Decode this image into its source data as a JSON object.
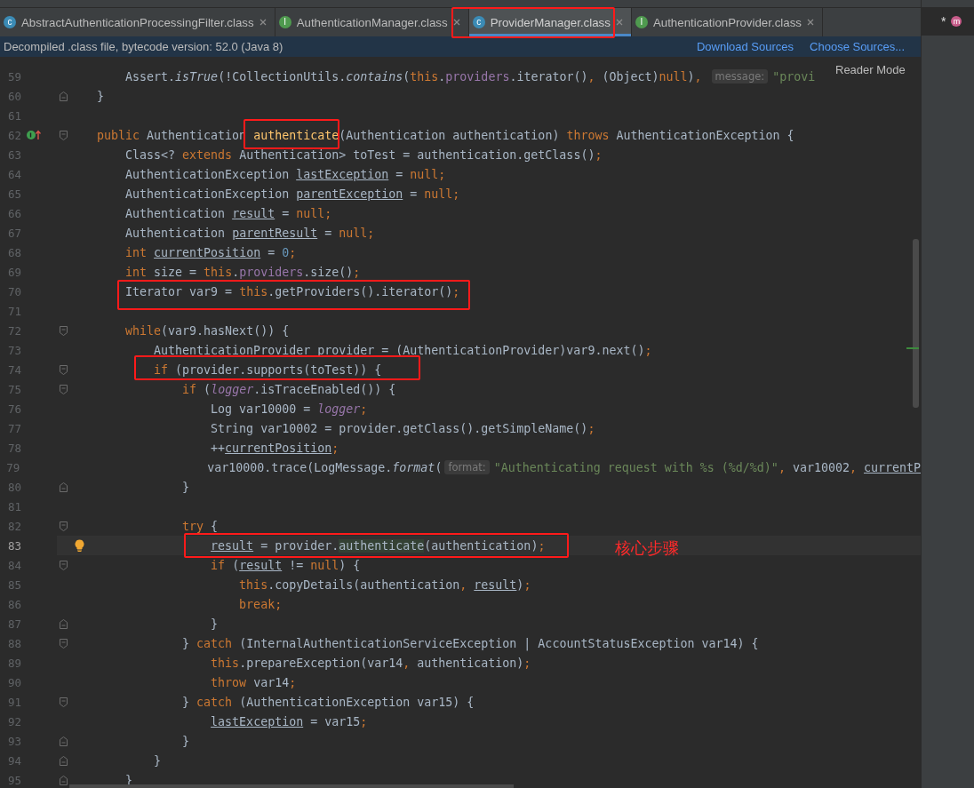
{
  "tabs": [
    {
      "label": "AbstractAuthenticationProcessingFilter.class",
      "kind": "class",
      "badge": "c",
      "selected": false
    },
    {
      "label": "AuthenticationManager.class",
      "kind": "interface",
      "badge": "I",
      "selected": false
    },
    {
      "label": "ProviderManager.class",
      "kind": "class",
      "badge": "c",
      "selected": true
    },
    {
      "label": "AuthenticationProvider.class",
      "kind": "interface",
      "badge": "I",
      "selected": false
    }
  ],
  "side_panel": {
    "mark": "*",
    "badge": "m"
  },
  "info_bar": {
    "message": "Decompiled .class file, bytecode version: 52.0 (Java 8)",
    "links": [
      "Download Sources",
      "Choose Sources..."
    ]
  },
  "reader_mode": "Reader Mode",
  "lines": [
    {
      "no": "59",
      "tokens": [
        {
          "kind": "plain",
          "text": "    Assert."
        },
        {
          "kind": "italic",
          "text": "isTrue"
        },
        {
          "kind": "plain",
          "text": "(!CollectionUtils."
        },
        {
          "kind": "italic",
          "text": "contains"
        },
        {
          "kind": "plain",
          "text": "("
        },
        {
          "kind": "keyword",
          "text": "this"
        },
        {
          "kind": "plain",
          "text": "."
        },
        {
          "kind": "field",
          "text": "providers"
        },
        {
          "kind": "plain",
          "text": ".iterator()"
        },
        {
          "kind": "keyword",
          "text": ", "
        },
        {
          "kind": "plain",
          "text": "(Object)"
        },
        {
          "kind": "keyword",
          "text": "null"
        },
        {
          "kind": "plain",
          "text": ")"
        },
        {
          "kind": "keyword",
          "text": ", "
        },
        {
          "kind": "hint",
          "text": "message:"
        },
        {
          "kind": "string",
          "text": "\"provi"
        }
      ]
    },
    {
      "no": "60",
      "fold": {
        "kind": "end"
      },
      "tokens": [
        {
          "kind": "plain",
          "text": "}"
        }
      ]
    },
    {
      "no": "61"
    },
    {
      "no": "62",
      "fold": {
        "kind": "start"
      },
      "gutter": {
        "kind": "implements"
      },
      "tokens": [
        {
          "kind": "keyword",
          "text": "public "
        },
        {
          "kind": "plain",
          "text": "Authentication "
        },
        {
          "kind": "declaration",
          "text": "authenticate"
        },
        {
          "kind": "plain",
          "text": "(Authentication authentication) "
        },
        {
          "kind": "keyword",
          "text": "throws "
        },
        {
          "kind": "plain",
          "text": "AuthenticationException {"
        }
      ]
    },
    {
      "no": "63",
      "tokens": [
        {
          "kind": "plain",
          "text": "    Class<? "
        },
        {
          "kind": "keyword",
          "text": "extends "
        },
        {
          "kind": "plain",
          "text": "Authentication> toTest = authentication.getClass()"
        },
        {
          "kind": "keyword",
          "text": ";"
        }
      ]
    },
    {
      "no": "64",
      "tokens": [
        {
          "kind": "plain",
          "text": "    AuthenticationException "
        },
        {
          "kind": "local",
          "text": "lastException"
        },
        {
          "kind": "plain",
          "text": " = "
        },
        {
          "kind": "keyword",
          "text": "null;"
        }
      ]
    },
    {
      "no": "65",
      "tokens": [
        {
          "kind": "plain",
          "text": "    AuthenticationException "
        },
        {
          "kind": "local",
          "text": "parentException"
        },
        {
          "kind": "plain",
          "text": " = "
        },
        {
          "kind": "keyword",
          "text": "null;"
        }
      ]
    },
    {
      "no": "66",
      "tokens": [
        {
          "kind": "plain",
          "text": "    Authentication "
        },
        {
          "kind": "local",
          "text": "result"
        },
        {
          "kind": "plain",
          "text": " = "
        },
        {
          "kind": "keyword",
          "text": "null;"
        }
      ]
    },
    {
      "no": "67",
      "tokens": [
        {
          "kind": "plain",
          "text": "    Authentication "
        },
        {
          "kind": "local",
          "text": "parentResult"
        },
        {
          "kind": "plain",
          "text": " = "
        },
        {
          "kind": "keyword",
          "text": "null;"
        }
      ]
    },
    {
      "no": "68",
      "tokens": [
        {
          "kind": "keyword",
          "text": "    int "
        },
        {
          "kind": "local",
          "text": "currentPosition"
        },
        {
          "kind": "plain",
          "text": " = "
        },
        {
          "kind": "number",
          "text": "0"
        },
        {
          "kind": "keyword",
          "text": ";"
        }
      ]
    },
    {
      "no": "69",
      "tokens": [
        {
          "kind": "keyword",
          "text": "    int "
        },
        {
          "kind": "plain",
          "text": "size = "
        },
        {
          "kind": "keyword",
          "text": "this"
        },
        {
          "kind": "plain",
          "text": "."
        },
        {
          "kind": "field",
          "text": "providers"
        },
        {
          "kind": "plain",
          "text": ".size()"
        },
        {
          "kind": "keyword",
          "text": ";"
        }
      ]
    },
    {
      "no": "70",
      "tokens": [
        {
          "kind": "plain",
          "text": "    Iterator var9 = "
        },
        {
          "kind": "keyword",
          "text": "this"
        },
        {
          "kind": "plain",
          "text": ".getProviders().iterator()"
        },
        {
          "kind": "keyword",
          "text": ";"
        }
      ]
    },
    {
      "no": "71"
    },
    {
      "no": "72",
      "fold": {
        "kind": "start"
      },
      "tokens": [
        {
          "kind": "keyword",
          "text": "    while"
        },
        {
          "kind": "plain",
          "text": "(var9.hasNext()) {"
        }
      ]
    },
    {
      "no": "73",
      "tokens": [
        {
          "kind": "plain",
          "text": "        AuthenticationProvider provider = (AuthenticationProvider)var9.next()"
        },
        {
          "kind": "keyword",
          "text": ";"
        }
      ]
    },
    {
      "no": "74",
      "fold": {
        "kind": "start"
      },
      "tokens": [
        {
          "kind": "keyword",
          "text": "        if "
        },
        {
          "kind": "plain",
          "text": "(provider.supports(toTest)) {"
        }
      ]
    },
    {
      "no": "75",
      "fold": {
        "kind": "start"
      },
      "tokens": [
        {
          "kind": "keyword",
          "text": "            if "
        },
        {
          "kind": "plain",
          "text": "("
        },
        {
          "kind": "static",
          "text": "logger"
        },
        {
          "kind": "plain",
          "text": ".isTraceEnabled()) {"
        }
      ]
    },
    {
      "no": "76",
      "tokens": [
        {
          "kind": "plain",
          "text": "                Log var10000 = "
        },
        {
          "kind": "static",
          "text": "logger"
        },
        {
          "kind": "keyword",
          "text": ";"
        }
      ]
    },
    {
      "no": "77",
      "tokens": [
        {
          "kind": "plain",
          "text": "                String var10002 = provider.getClass().getSimpleName()"
        },
        {
          "kind": "keyword",
          "text": ";"
        }
      ]
    },
    {
      "no": "78",
      "tokens": [
        {
          "kind": "plain",
          "text": "                ++"
        },
        {
          "kind": "local",
          "text": "currentPosition"
        },
        {
          "kind": "keyword",
          "text": ";"
        }
      ]
    },
    {
      "no": "79",
      "tokens": [
        {
          "kind": "plain",
          "text": "                var10000.trace(LogMessage."
        },
        {
          "kind": "italic",
          "text": "format"
        },
        {
          "kind": "plain",
          "text": "("
        },
        {
          "kind": "hint",
          "text": "format:"
        },
        {
          "kind": "string",
          "text": "\"Authenticating request with %s (%d/%d)\""
        },
        {
          "kind": "keyword",
          "text": ", "
        },
        {
          "kind": "plain",
          "text": "var10002"
        },
        {
          "kind": "keyword",
          "text": ", "
        },
        {
          "kind": "local",
          "text": "currentP"
        }
      ]
    },
    {
      "no": "80",
      "fold": {
        "kind": "end"
      },
      "tokens": [
        {
          "kind": "plain",
          "text": "            }"
        }
      ]
    },
    {
      "no": "81"
    },
    {
      "no": "82",
      "fold": {
        "kind": "start"
      },
      "tokens": [
        {
          "kind": "keyword",
          "text": "            try "
        },
        {
          "kind": "plain",
          "text": "{"
        }
      ]
    },
    {
      "no": "83",
      "current": true,
      "gutter": {
        "kind": "bulb"
      },
      "tokens": [
        {
          "kind": "local",
          "text": "                result"
        },
        {
          "kind": "plain",
          "text": " = provider."
        },
        {
          "kind": "usage",
          "text": "authenticate"
        },
        {
          "kind": "plain",
          "text": "(authentication)"
        },
        {
          "kind": "keyword",
          "text": ";"
        }
      ]
    },
    {
      "no": "84",
      "fold": {
        "kind": "start"
      },
      "tokens": [
        {
          "kind": "keyword",
          "text": "                if "
        },
        {
          "kind": "plain",
          "text": "("
        },
        {
          "kind": "local",
          "text": "result"
        },
        {
          "kind": "plain",
          "text": " != "
        },
        {
          "kind": "keyword",
          "text": "null"
        },
        {
          "kind": "plain",
          "text": ") {"
        }
      ]
    },
    {
      "no": "85",
      "tokens": [
        {
          "kind": "keyword",
          "text": "                    this"
        },
        {
          "kind": "plain",
          "text": ".copyDetails(authentication"
        },
        {
          "kind": "keyword",
          "text": ", "
        },
        {
          "kind": "local",
          "text": "result"
        },
        {
          "kind": "plain",
          "text": ")"
        },
        {
          "kind": "keyword",
          "text": ";"
        }
      ]
    },
    {
      "no": "86",
      "tokens": [
        {
          "kind": "keyword",
          "text": "                    break;"
        }
      ]
    },
    {
      "no": "87",
      "fold": {
        "kind": "end"
      },
      "tokens": [
        {
          "kind": "plain",
          "text": "                }"
        }
      ]
    },
    {
      "no": "88",
      "fold": {
        "kind": "start"
      },
      "tokens": [
        {
          "kind": "plain",
          "text": "            } "
        },
        {
          "kind": "keyword",
          "text": "catch "
        },
        {
          "kind": "plain",
          "text": "(InternalAuthenticationServiceException | AccountStatusException var14) {"
        }
      ]
    },
    {
      "no": "89",
      "tokens": [
        {
          "kind": "keyword",
          "text": "                this"
        },
        {
          "kind": "plain",
          "text": ".prepareException(var14"
        },
        {
          "kind": "keyword",
          "text": ", "
        },
        {
          "kind": "plain",
          "text": "authentication)"
        },
        {
          "kind": "keyword",
          "text": ";"
        }
      ]
    },
    {
      "no": "90",
      "tokens": [
        {
          "kind": "keyword",
          "text": "                throw "
        },
        {
          "kind": "plain",
          "text": "var14"
        },
        {
          "kind": "keyword",
          "text": ";"
        }
      ]
    },
    {
      "no": "91",
      "fold": {
        "kind": "start"
      },
      "tokens": [
        {
          "kind": "plain",
          "text": "            } "
        },
        {
          "kind": "keyword",
          "text": "catch "
        },
        {
          "kind": "plain",
          "text": "(AuthenticationException var15) {"
        }
      ]
    },
    {
      "no": "92",
      "tokens": [
        {
          "kind": "local",
          "text": "                lastException"
        },
        {
          "kind": "plain",
          "text": " = var15"
        },
        {
          "kind": "keyword",
          "text": ";"
        }
      ]
    },
    {
      "no": "93",
      "fold": {
        "kind": "end"
      },
      "tokens": [
        {
          "kind": "plain",
          "text": "            }"
        }
      ]
    },
    {
      "no": "94",
      "fold": {
        "kind": "end"
      },
      "tokens": [
        {
          "kind": "plain",
          "text": "        }"
        }
      ]
    },
    {
      "no": "95",
      "fold": {
        "kind": "end"
      },
      "tokens": [
        {
          "kind": "plain",
          "text": "    }"
        }
      ]
    }
  ],
  "annotation_note": "核心步骤"
}
